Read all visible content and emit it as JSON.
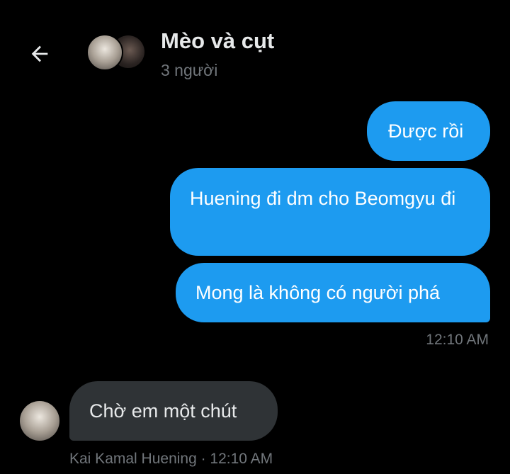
{
  "header": {
    "back_icon": "arrow-left-icon",
    "title": "Mèo và cụt",
    "subtitle": "3 người"
  },
  "messages": {
    "sent": [
      {
        "text": "Được rồi"
      },
      {
        "text": "Huening đi dm cho Beomgyu đi"
      },
      {
        "text": "Mong là không có người phá"
      }
    ],
    "sent_time": "12:10 AM",
    "received": [
      {
        "text": "Chờ em một chút"
      }
    ],
    "received_sender": "Kai Kamal Huening",
    "received_time": "12:10 AM",
    "received_meta": "Kai Kamal Huening · 12:10 AM"
  },
  "colors": {
    "background": "#000000",
    "sent_bubble": "#1d9bf0",
    "received_bubble": "#2f3336",
    "secondary_text": "#71767b"
  }
}
